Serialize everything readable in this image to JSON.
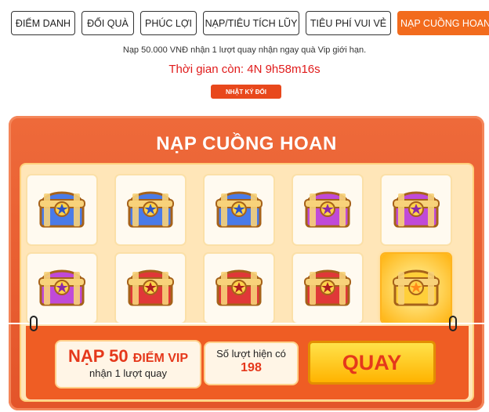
{
  "tabs": [
    {
      "label": "ĐIỂM DANH"
    },
    {
      "label": "ĐỔI QUÀ"
    },
    {
      "label": "PHÚC LỢI"
    },
    {
      "label": "NẠP/TIÊU TÍCH LŨY"
    },
    {
      "label": "TIÊU PHÍ VUI VẺ"
    },
    {
      "label": "NẠP CUỒNG HOAN"
    }
  ],
  "subline": "Nạp 50.000 VNĐ nhận 1 lượt quay nhận ngay quà Vip giới hạn.",
  "timer": "Thời gian còn: 4N 9h58m16s",
  "history_button": "NHẬT KÝ ĐỔI",
  "panel": {
    "title": "NẠP CUỒNG HOAN",
    "chests": [
      {
        "type": "blue"
      },
      {
        "type": "blue"
      },
      {
        "type": "blue"
      },
      {
        "type": "purple"
      },
      {
        "type": "purple"
      },
      {
        "type": "purple"
      },
      {
        "type": "red"
      },
      {
        "type": "red"
      },
      {
        "type": "red"
      },
      {
        "type": "special"
      }
    ],
    "vip": {
      "prefix": "NẠP 50",
      "suffix": "ĐIỂM VIP",
      "sub": "nhận 1 lượt quay"
    },
    "count": {
      "label": "Số lượt hiện có",
      "value": "198"
    },
    "spin_button": "QUAY"
  },
  "colors": {
    "accent": "#f26b1d",
    "panel": "#e85b2c",
    "timer": "#e01b1b"
  }
}
